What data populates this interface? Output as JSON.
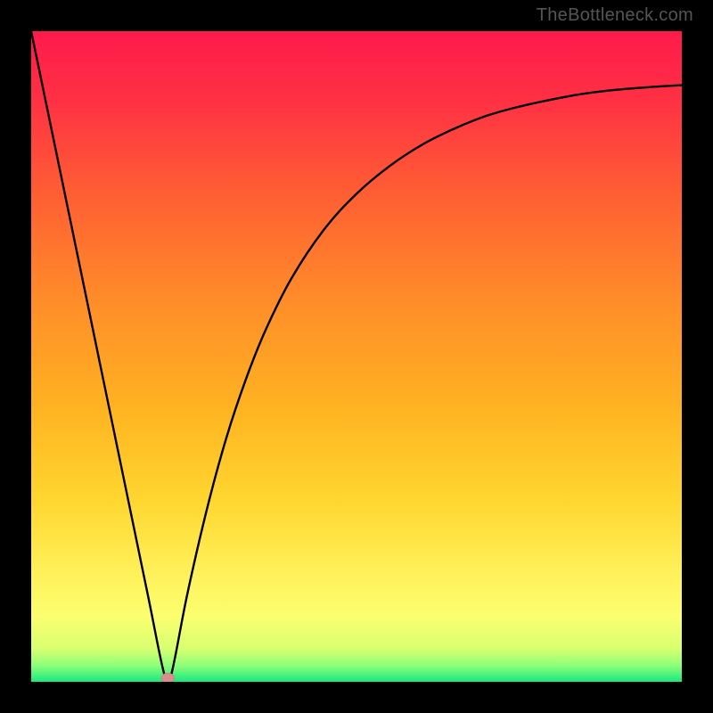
{
  "watermark": "TheBottleneck.com",
  "colors": {
    "frame": "#000000",
    "top": "#ff1744",
    "mid": "#ffb300",
    "yellow": "#fff176",
    "green": "#00e676",
    "curve": "#000000",
    "marker": "#d98080"
  },
  "chart_data": {
    "type": "line",
    "title": "",
    "xlabel": "",
    "ylabel": "",
    "xlim": [
      0,
      1
    ],
    "ylim": [
      0,
      1
    ],
    "x": [
      0.0,
      0.03,
      0.06,
      0.09,
      0.12,
      0.15,
      0.18,
      0.205,
      0.215,
      0.24,
      0.27,
      0.3,
      0.33,
      0.36,
      0.4,
      0.45,
      0.5,
      0.55,
      0.6,
      0.65,
      0.7,
      0.75,
      0.8,
      0.85,
      0.9,
      0.95,
      1.0
    ],
    "y": [
      1.0,
      0.855,
      0.71,
      0.565,
      0.42,
      0.275,
      0.13,
      0.01,
      0.01,
      0.135,
      0.265,
      0.375,
      0.465,
      0.54,
      0.62,
      0.695,
      0.75,
      0.792,
      0.825,
      0.85,
      0.87,
      0.884,
      0.895,
      0.904,
      0.91,
      0.914,
      0.917
    ],
    "marker": {
      "x": 0.21,
      "y": 0.006
    }
  }
}
